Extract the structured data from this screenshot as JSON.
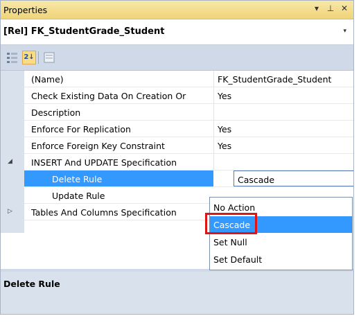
{
  "window": {
    "title": "Properties",
    "controls": [
      "▾",
      "⊥",
      "✕"
    ]
  },
  "object_selector": {
    "value": "[Rel] FK_StudentGrade_Student",
    "arrow": "▾"
  },
  "toolbar": {
    "categorized_icon": "categorized-icon",
    "alphabetical_icon": "sort-alphabetical-icon",
    "alphabetical_label": "2↓",
    "pages_icon": "property-pages-icon"
  },
  "properties": {
    "name": {
      "label": "(Name)",
      "value": "FK_StudentGrade_Student"
    },
    "check_existing": {
      "label": "Check Existing Data On Creation Or",
      "value": "Yes"
    },
    "description": {
      "label": "Description",
      "value": ""
    },
    "enforce_replication": {
      "label": "Enforce For Replication",
      "value": "Yes"
    },
    "enforce_fk": {
      "label": "Enforce Foreign Key Constraint",
      "value": "Yes"
    },
    "insert_update": {
      "label": "INSERT And UPDATE Specification",
      "expander": "◢"
    },
    "delete_rule": {
      "label": "Delete Rule",
      "value": "Cascade"
    },
    "update_rule": {
      "label": "Update Rule"
    },
    "tables_columns": {
      "label": "Tables And Columns Specification",
      "expander": "▷"
    }
  },
  "dropdown": {
    "options": [
      "No Action",
      "Cascade",
      "Set Null",
      "Set Default"
    ],
    "highlighted": "Cascade"
  },
  "help": {
    "title": "Delete Rule"
  },
  "colors": {
    "selection": "#3399ff",
    "title_gradient_top": "#f7e8a8",
    "highlight_box": "#e01414"
  }
}
